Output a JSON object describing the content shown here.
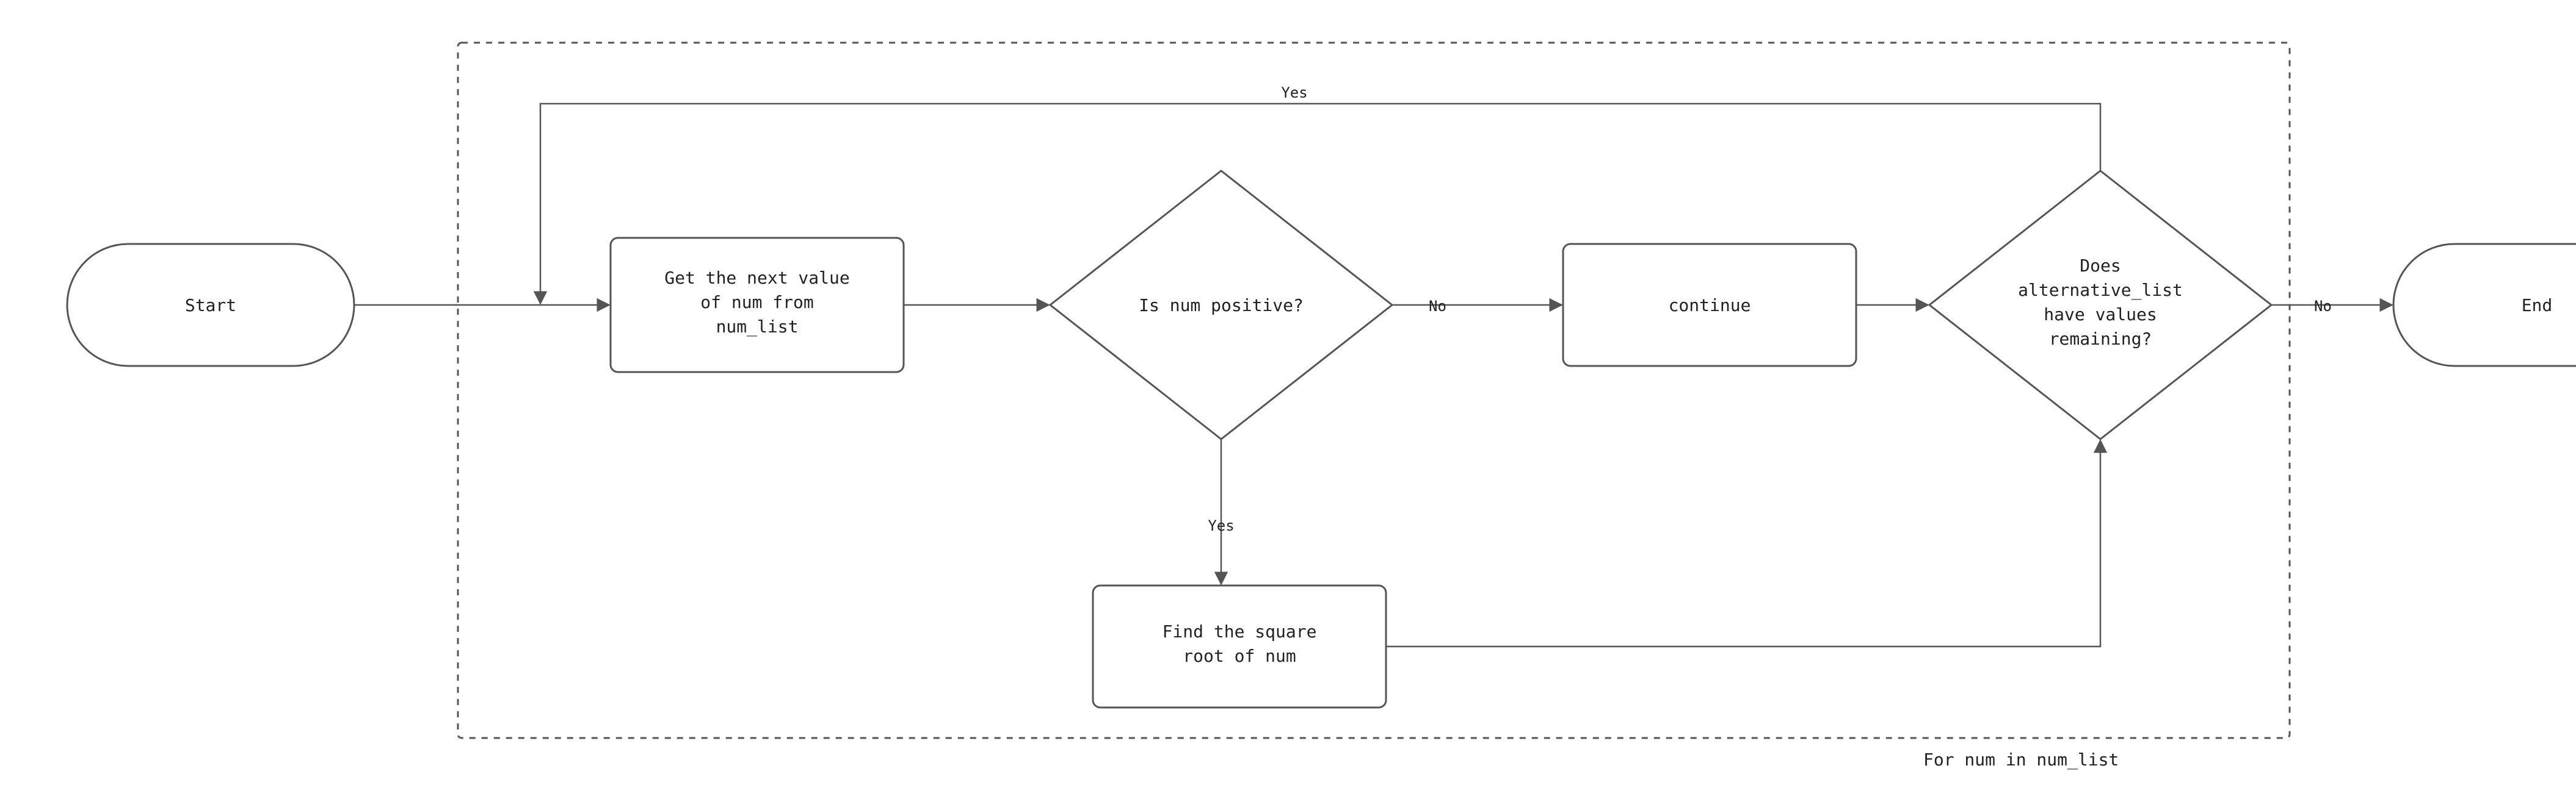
{
  "nodes": {
    "start": {
      "label": "Start"
    },
    "get_next": {
      "line1": "Get the next value",
      "line2": "of num from",
      "line3": "num_list"
    },
    "is_positive": {
      "label": "Is num positive?"
    },
    "continue": {
      "label": "continue"
    },
    "remaining": {
      "line1": "Does",
      "line2": "alternative_list",
      "line3": "have values",
      "line4": "remaining?"
    },
    "sqrt": {
      "line1": "Find the square",
      "line2": "root of num"
    },
    "end": {
      "label": "End"
    }
  },
  "edges": {
    "is_positive_yes": "Yes",
    "is_positive_no": "No",
    "remaining_yes": "Yes",
    "remaining_no": "No"
  },
  "container_caption": "For num in num_list"
}
